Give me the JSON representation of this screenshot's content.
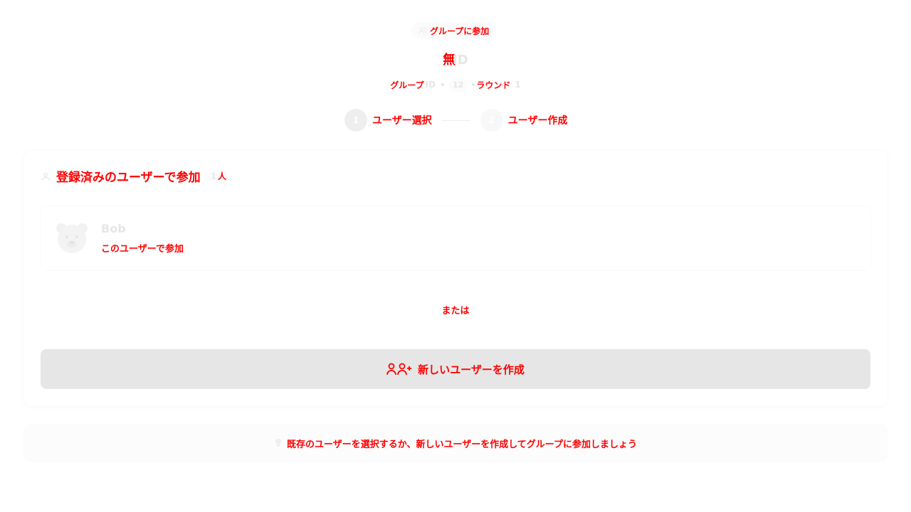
{
  "header": {
    "join_pill": "グループに参加",
    "title_main": "無",
    "title_suffix": "ID",
    "group_label": "グループ",
    "group_id_suffix": "ID",
    "group_chip_value": "12",
    "round_label": "ラウンド",
    "round_value": "1"
  },
  "steps": [
    {
      "number": "1",
      "label": "ユーザー選択"
    },
    {
      "number": "2",
      "label": "ユーザー作成"
    }
  ],
  "existing_users": {
    "heading": "登録済みのユーザーで参加",
    "count": "1",
    "count_unit": "人",
    "users": [
      {
        "name": "Bob",
        "action": "このユーザーで参加"
      }
    ]
  },
  "divider_text": "または",
  "create_button": {
    "label": "新しいユーザーを作成"
  },
  "hint": {
    "text": "既存のユーザーを選択するか、新しいユーザーを作成してグループに参加しましょう"
  },
  "colors": {
    "text_accent": "#ff0000",
    "faint_text": "#e6e6e6",
    "button_bg": "#e6e6e6"
  }
}
